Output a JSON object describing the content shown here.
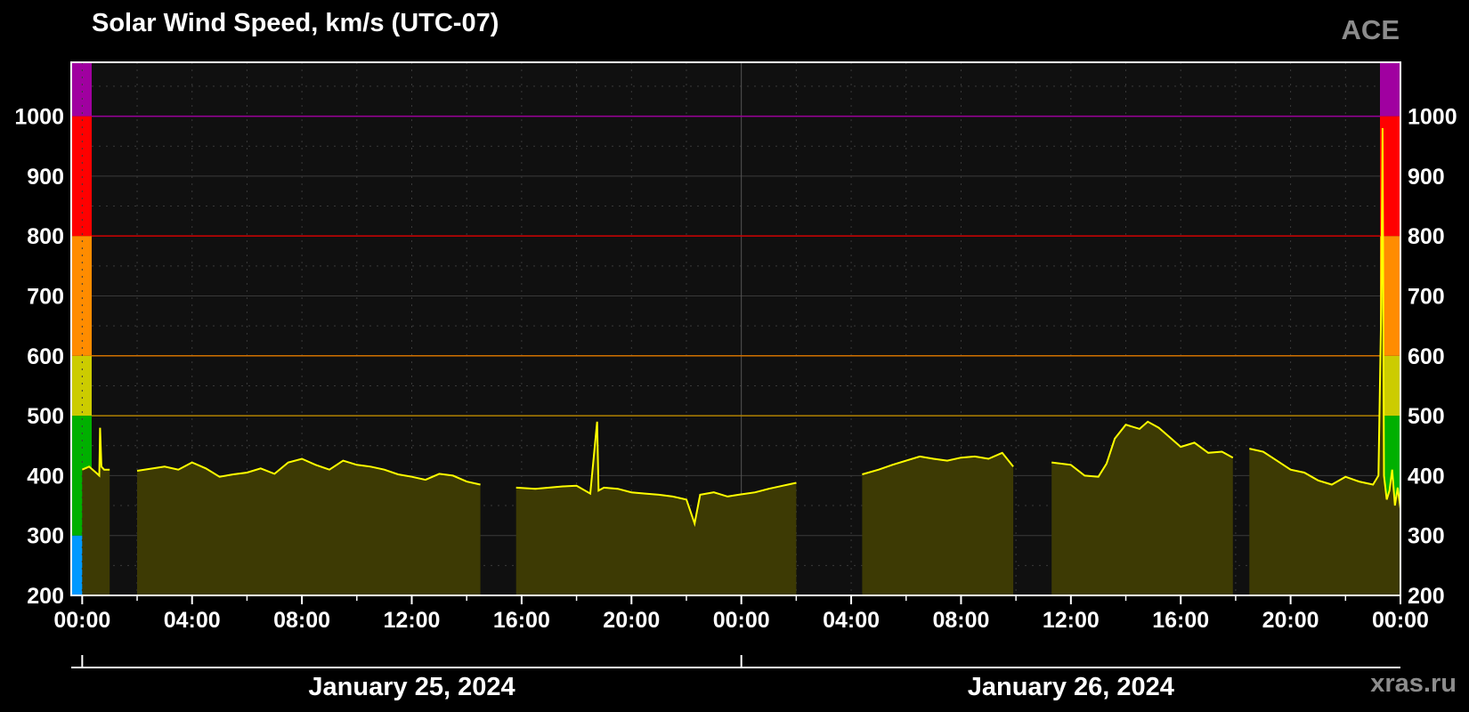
{
  "header": {
    "title": "Solar Wind Speed, km/s (UTC-07)",
    "source": "ACE",
    "watermark": "xras.ru"
  },
  "colors": {
    "background": "#000000",
    "plot_background": "#101010",
    "frame": "#ffffff",
    "grid": "#3a3a3a",
    "line": "#ffff00",
    "fill": "#3d3a04",
    "threshold_1000": "#9a009a",
    "threshold_800": "#d00000",
    "threshold_600": "#d07000",
    "threshold_500": "#b08000",
    "bands": {
      "200-300": "#0099ff",
      "300-500": "#00b000",
      "500-600": "#cccc00",
      "600-800": "#ff8c00",
      "800-1000": "#ff0000",
      "1000+": "#a000a0"
    }
  },
  "chart_data": {
    "type": "area",
    "title": "Solar Wind Speed, km/s (UTC-07)",
    "xlabel": "",
    "ylabel": "",
    "x_unit": "hours since 2024-01-25 00:00 (UTC-07)",
    "xlim": [
      -0.4,
      48
    ],
    "ylim": [
      200,
      1090
    ],
    "y_ticks": [
      "200",
      "300",
      "400",
      "500",
      "600",
      "700",
      "800",
      "900",
      "1000"
    ],
    "x_ticks": [
      "00:00",
      "04:00",
      "08:00",
      "12:00",
      "16:00",
      "20:00",
      "00:00",
      "04:00",
      "08:00",
      "12:00",
      "16:00",
      "20:00",
      "00:00"
    ],
    "date_labels": [
      "January 25, 2024",
      "January 26, 2024"
    ],
    "thresholds": [
      500,
      600,
      800,
      1000
    ],
    "color_bands": [
      {
        "from": 200,
        "to": 300,
        "color": "#0099ff"
      },
      {
        "from": 300,
        "to": 500,
        "color": "#00b000"
      },
      {
        "from": 500,
        "to": 600,
        "color": "#cccc00"
      },
      {
        "from": 600,
        "to": 800,
        "color": "#ff8c00"
      },
      {
        "from": 800,
        "to": 1000,
        "color": "#ff0000"
      },
      {
        "from": 1000,
        "to": 1090,
        "color": "#a000a0"
      }
    ],
    "series": [
      {
        "segments": [
          {
            "x": [
              0.0,
              0.25,
              0.5,
              0.62,
              0.65,
              0.7,
              0.8,
              1.0
            ],
            "y": [
              410,
              415,
              405,
              400,
              480,
              415,
              410,
              410
            ]
          },
          {
            "x": [
              2.0,
              3.0,
              3.5,
              4.0,
              4.5,
              5.0,
              5.5,
              6.0,
              6.5,
              7.0,
              7.5,
              8.0,
              8.5,
              9.0,
              9.5,
              10.0,
              10.5,
              11.0,
              11.5,
              12.0,
              12.5,
              13.0,
              13.5,
              14.0,
              14.5
            ],
            "y": [
              408,
              415,
              410,
              422,
              412,
              398,
              402,
              405,
              412,
              403,
              422,
              428,
              418,
              410,
              425,
              418,
              415,
              410,
              402,
              398,
              393,
              403,
              400,
              390,
              385
            ]
          },
          {
            "x": [
              15.8,
              16.5,
              17.5,
              18.0,
              18.5,
              18.75,
              18.8,
              19.0,
              19.5,
              20.0,
              20.5,
              21.0,
              21.5,
              22.0,
              22.3,
              22.5,
              23.0,
              23.5,
              23.9,
              24.5,
              25.0,
              25.5,
              26.0
            ],
            "y": [
              380,
              378,
              382,
              383,
              370,
              490,
              375,
              380,
              378,
              372,
              370,
              368,
              365,
              360,
              320,
              368,
              372,
              365,
              368,
              372,
              378,
              383,
              388
            ]
          },
          {
            "x": [
              28.4,
              29.0,
              29.5,
              30.0,
              30.5,
              31.0,
              31.5,
              32.0,
              32.5,
              33.0,
              33.5,
              33.9
            ],
            "y": [
              402,
              410,
              418,
              425,
              432,
              428,
              425,
              430,
              432,
              428,
              438,
              415
            ]
          },
          {
            "x": [
              35.3,
              36.0,
              36.5,
              37.0,
              37.3,
              37.6,
              38.0,
              38.5,
              38.8,
              39.2,
              39.5,
              40.0,
              40.5,
              41.0,
              41.5,
              41.9
            ],
            "y": [
              422,
              418,
              400,
              398,
              420,
              462,
              485,
              478,
              490,
              480,
              468,
              448,
              455,
              438,
              440,
              430
            ]
          },
          {
            "x": [
              42.5,
              43.0,
              43.5,
              44.0,
              44.5,
              45.0,
              45.5,
              46.0,
              46.5,
              47.0,
              47.2,
              47.3,
              47.35,
              47.4,
              47.5,
              47.6,
              47.7,
              47.8,
              47.9,
              48.0
            ],
            "y": [
              445,
              440,
              425,
              410,
              405,
              392,
              385,
              398,
              390,
              385,
              400,
              680,
              980,
              400,
              360,
              375,
              410,
              350,
              380,
              345
            ]
          }
        ]
      }
    ]
  }
}
